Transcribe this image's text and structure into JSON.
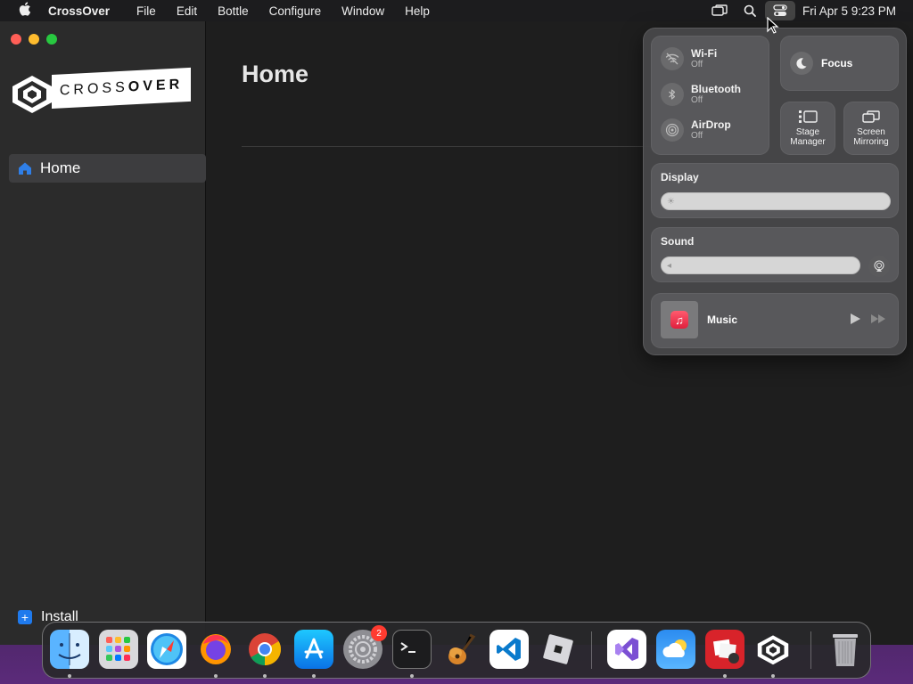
{
  "menubar": {
    "app_name": "CrossOver",
    "menus": [
      "File",
      "Edit",
      "Bottle",
      "Configure",
      "Window",
      "Help"
    ],
    "clock": "Fri Apr 5  9:23 PM"
  },
  "sidebar": {
    "logo_text_light": "CROSS",
    "logo_text_bold": "OVER",
    "nav_home": "Home",
    "install_label": "Install"
  },
  "main": {
    "title": "Home"
  },
  "control_center": {
    "wifi": {
      "name": "Wi-Fi",
      "state": "Off"
    },
    "bluetooth": {
      "name": "Bluetooth",
      "state": "Off"
    },
    "airdrop": {
      "name": "AirDrop",
      "state": "Off"
    },
    "focus": "Focus",
    "stage_manager": "Stage Manager",
    "screen_mirroring": "Screen Mirroring",
    "display_label": "Display",
    "sound_label": "Sound",
    "now_playing": "Music",
    "display_level": 0.0,
    "sound_level": 0.0
  },
  "dock": {
    "apps": [
      "finder",
      "launchpad",
      "safari",
      "firefox",
      "chrome",
      "app-store",
      "system-settings",
      "terminal",
      "garageband",
      "vscode",
      "roblox",
      "visual-studio",
      "weather",
      "photo-booth",
      "crossover",
      "trash"
    ],
    "system_settings_badge": "2"
  },
  "colors": {
    "accent": "#1f7aed",
    "close": "#ff5f57",
    "minimize": "#febc2e",
    "maximize": "#28c840"
  }
}
